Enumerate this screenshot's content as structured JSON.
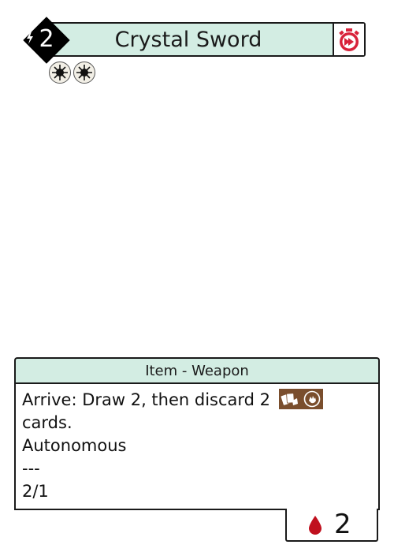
{
  "card": {
    "cost": "2",
    "name": "Crystal Sword",
    "type_line": "Item - Weapon",
    "rules_text": [
      "Arrive: Draw 2, then discard 2",
      "cards.",
      "Autonomous",
      "---",
      "2/1"
    ],
    "blood_cost": "2",
    "icons": {
      "cost_symbol": "lightning-bolt-icon",
      "speed": "fast-stopwatch-icon",
      "traits": [
        "sun-icon",
        "sun-icon"
      ],
      "inline": [
        "cards-icon",
        "hand-icon"
      ],
      "blood": "blood-drop-icon"
    }
  },
  "colors": {
    "header_fill": "#d3ede3",
    "cost_diamond": "#000000",
    "speed_red": "#d8223a",
    "inline_icon_bg": "#7a4e2d",
    "blood_red": "#c0101e"
  }
}
